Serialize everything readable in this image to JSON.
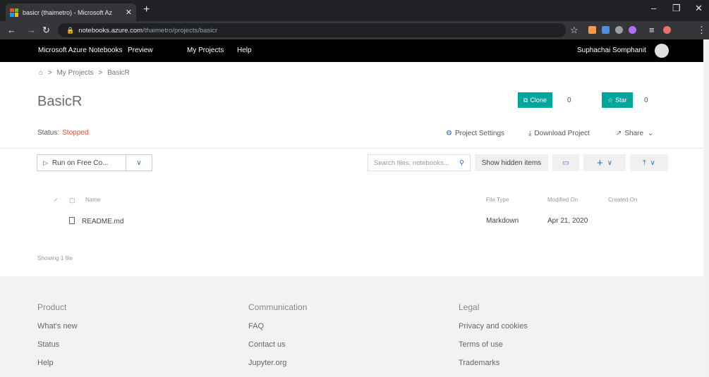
{
  "browser": {
    "tab_title": "basicr (thaimetro) - Microsoft Az",
    "url_host": "notebooks.azure.com",
    "url_path": "/thaimetro/projects/basicr"
  },
  "header": {
    "brand": "Microsoft Azure Notebooks",
    "preview": "Preview",
    "nav": [
      "My Projects",
      "Help"
    ],
    "user": "Suphachai Somphanit"
  },
  "breadcrumb": {
    "sep": ">",
    "my_projects": "My Projects",
    "current": "BasicR"
  },
  "project": {
    "title": "BasicR",
    "clone_label": "Clone",
    "clone_count": "0",
    "star_label": "Star",
    "star_count": "0",
    "status_label": "Status:",
    "status_value": "Stopped",
    "status_color": "#e04e2c"
  },
  "actions": {
    "project_settings": "Project Settings",
    "download_project": "Download Project",
    "share": "Share"
  },
  "toolbar": {
    "run_label": "Run on Free Co...",
    "search_placeholder": "Search files, notebooks...",
    "show_hidden": "Show hidden items"
  },
  "table": {
    "headers": {
      "name": "Name",
      "file_type": "File Type",
      "modified": "Modified On",
      "created": "Created On"
    },
    "rows": [
      {
        "name": "README.md",
        "file_type": "Markdown",
        "modified": "Apr 21, 2020",
        "created": ""
      }
    ],
    "showing": "Showing 1 file"
  },
  "footer": {
    "product": {
      "title": "Product",
      "links": [
        "What's new",
        "Status",
        "Help"
      ]
    },
    "communication": {
      "title": "Communication",
      "links": [
        "FAQ",
        "Contact us",
        "Jupyter.org"
      ]
    },
    "legal": {
      "title": "Legal",
      "links": [
        "Privacy and cookies",
        "Terms of use",
        "Trademarks"
      ]
    }
  },
  "colors": {
    "accent_green": "#00a69c",
    "link_blue": "#2c6fbf"
  }
}
